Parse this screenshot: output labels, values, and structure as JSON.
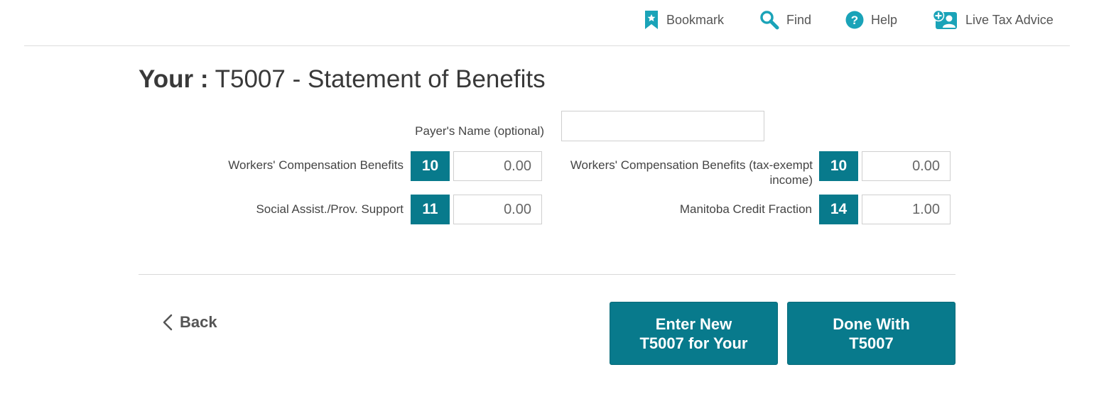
{
  "toolbar": {
    "bookmark": {
      "label": "Bookmark",
      "icon": "bookmark-icon"
    },
    "find": {
      "label": "Find",
      "icon": "search-icon"
    },
    "help": {
      "label": "Help",
      "icon": "help-icon"
    },
    "live": {
      "label": "Live Tax Advice",
      "icon": "live-advice-icon"
    }
  },
  "title": {
    "prefix": "Your :",
    "text": "T5007 - Statement of Benefits"
  },
  "form": {
    "payer_name": {
      "label": "Payer's Name (optional)",
      "value": "",
      "placeholder": ""
    },
    "workers_comp": {
      "label": "Workers' Compensation Benefits",
      "box": "10",
      "value": "0.00"
    },
    "workers_comp_exempt": {
      "label_line1": "Workers' Compensation Benefits (tax-exempt",
      "label_line2": "income)",
      "box": "10",
      "value": "0.00"
    },
    "social_assist": {
      "label": "Social Assist./Prov. Support",
      "box": "11",
      "value": "0.00"
    },
    "manitoba_credit": {
      "label": "Manitoba Credit Fraction",
      "box": "14",
      "value": "1.00"
    }
  },
  "nav": {
    "back_label": "Back"
  },
  "actions": {
    "enter_new_line1": "Enter New",
    "enter_new_line2": "T5007 for Your",
    "done_line1": "Done With",
    "done_line2": "T5007"
  },
  "colors": {
    "accent": "#087a8c",
    "icon": "#1aa3b8"
  }
}
